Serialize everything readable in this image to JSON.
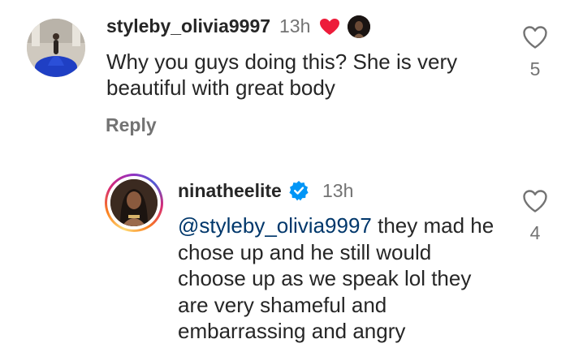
{
  "comments": [
    {
      "username": "styleby_olivia9997",
      "time": "13h",
      "text": "Why you guys doing this? She is very beautiful with great body",
      "reply_label": "Reply",
      "likes": "5",
      "liked_by_author": true,
      "icons": {
        "like": "heart-outline-icon",
        "author_like": "heart-filled-icon"
      },
      "colors": {
        "author_heart": "#ed1c3a"
      }
    },
    {
      "username": "ninatheelite",
      "verified": true,
      "time": "13h",
      "mention": "@styleby_olivia9997",
      "text": " they mad he chose up and he still would choose up as we speak lol they are very shameful and embarrassing and angry",
      "likes": "4",
      "has_story_ring": true,
      "icons": {
        "like": "heart-outline-icon",
        "verified": "verified-badge-icon"
      },
      "colors": {
        "verified": "#0095f6",
        "mention": "#00376b"
      }
    }
  ]
}
